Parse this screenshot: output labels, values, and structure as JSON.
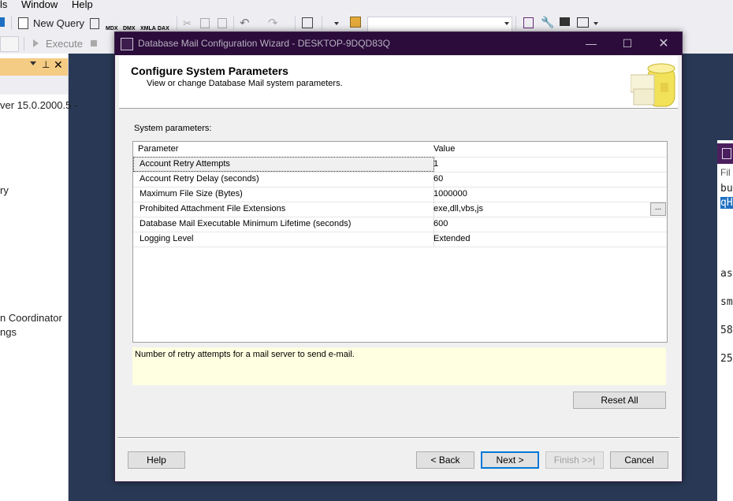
{
  "menu": {
    "items": [
      "ls",
      "Window",
      "Help"
    ]
  },
  "toolbar": {
    "new_query_label": "New Query",
    "execute_label": "Execute",
    "icons": [
      "mdx-icon",
      "dmx-icon",
      "xmla-icon",
      "dax-icon"
    ],
    "icon_labels": [
      "MDX",
      "DMX",
      "XMLA",
      "DAX"
    ]
  },
  "object_explorer": {
    "lines": [
      "ver 15.0.2000.5 -",
      "ry",
      "n Coordinator",
      "ngs"
    ]
  },
  "right_fragment": {
    "lines": [
      "Fil",
      "bu",
      "qH",
      "as",
      "sm",
      "58",
      "25"
    ]
  },
  "dialog": {
    "title": "Database Mail Configuration Wizard - DESKTOP-9DQD83Q",
    "header_title": "Configure System Parameters",
    "header_subtitle": "View or change Database Mail system parameters.",
    "section_label": "System parameters:",
    "columns": [
      "Parameter",
      "Value"
    ],
    "rows": [
      {
        "parameter": "Account Retry Attempts",
        "value": "1"
      },
      {
        "parameter": "Account Retry Delay (seconds)",
        "value": "60"
      },
      {
        "parameter": "Maximum File Size (Bytes)",
        "value": "1000000"
      },
      {
        "parameter": "Prohibited Attachment File Extensions",
        "value": "exe,dll,vbs,js"
      },
      {
        "parameter": "Database Mail Executable Minimum Lifetime (seconds)",
        "value": "600"
      },
      {
        "parameter": "Logging Level",
        "value": "Extended"
      }
    ],
    "ellipsis_label": "...",
    "description": "Number of retry attempts for a mail server to send e-mail.",
    "reset_label": "Reset All",
    "buttons": {
      "help": "Help",
      "back": "< Back",
      "next": "Next >",
      "finish": "Finish >>|",
      "cancel": "Cancel"
    }
  }
}
